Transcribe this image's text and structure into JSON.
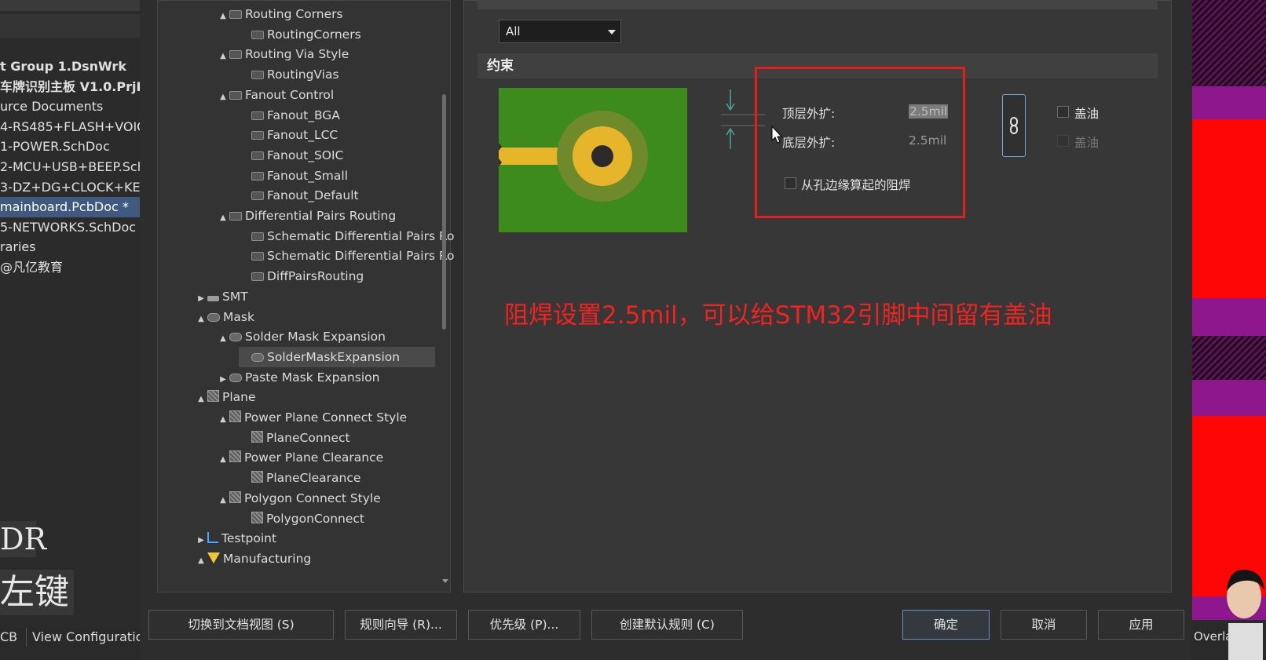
{
  "project_panel": {
    "items": [
      {
        "label": "t Group 1.DsnWrk",
        "bold": true,
        "selected": false
      },
      {
        "label": "车牌识别主板 V1.0.PrjP",
        "bold": true,
        "selected": false
      },
      {
        "label": "urce Documents",
        "bold": false,
        "selected": false
      },
      {
        "label": "4-RS485+FLASH+VOICI",
        "bold": false,
        "selected": false
      },
      {
        "label": "1-POWER.SchDoc",
        "bold": false,
        "selected": false
      },
      {
        "label": "2-MCU+USB+BEEP.SchI",
        "bold": false,
        "selected": false
      },
      {
        "label": "3-DZ+DG+CLOCK+KEY",
        "bold": false,
        "selected": false
      },
      {
        "label": "mainboard.PcbDoc *",
        "bold": false,
        "selected": true
      },
      {
        "label": "5-NETWORKS.SchDoc",
        "bold": false,
        "selected": false
      },
      {
        "label": "raries",
        "bold": false,
        "selected": false
      },
      {
        "label": "@凡亿教育",
        "bold": false,
        "selected": false
      }
    ],
    "overlay_text_1": "DR",
    "overlay_text_2": "左键",
    "bottom_tab_1": "CB",
    "bottom_tab_2": "View Configuration"
  },
  "rule_tree": {
    "nodes": [
      {
        "label": "Routing Corners",
        "level": 2,
        "arrow": "▲",
        "icon": "route"
      },
      {
        "label": "RoutingCorners",
        "level": 3,
        "arrow": "",
        "icon": "route"
      },
      {
        "label": "Routing Via Style",
        "level": 2,
        "arrow": "▲",
        "icon": "route"
      },
      {
        "label": "RoutingVias",
        "level": 3,
        "arrow": "",
        "icon": "route"
      },
      {
        "label": "Fanout Control",
        "level": 2,
        "arrow": "▲",
        "icon": "route"
      },
      {
        "label": "Fanout_BGA",
        "level": 3,
        "arrow": "",
        "icon": "route"
      },
      {
        "label": "Fanout_LCC",
        "level": 3,
        "arrow": "",
        "icon": "route"
      },
      {
        "label": "Fanout_SOIC",
        "level": 3,
        "arrow": "",
        "icon": "route"
      },
      {
        "label": "Fanout_Small",
        "level": 3,
        "arrow": "",
        "icon": "route"
      },
      {
        "label": "Fanout_Default",
        "level": 3,
        "arrow": "",
        "icon": "route"
      },
      {
        "label": "Differential Pairs Routing",
        "level": 2,
        "arrow": "▲",
        "icon": "route"
      },
      {
        "label": "Schematic Differential Pairs Ro",
        "level": 3,
        "arrow": "",
        "icon": "route"
      },
      {
        "label": "Schematic Differential Pairs Ro",
        "level": 3,
        "arrow": "",
        "icon": "route"
      },
      {
        "label": "DiffPairsRouting",
        "level": 3,
        "arrow": "",
        "icon": "route"
      },
      {
        "label": "SMT",
        "level": 1,
        "arrow": "▶",
        "icon": "smt"
      },
      {
        "label": "Mask",
        "level": 1,
        "arrow": "▲",
        "icon": "mask"
      },
      {
        "label": "Solder Mask Expansion",
        "level": 2,
        "arrow": "▲",
        "icon": "mask"
      },
      {
        "label": "SolderMaskExpansion",
        "level": 3,
        "arrow": "",
        "icon": "mask",
        "selected": true
      },
      {
        "label": "Paste Mask Expansion",
        "level": 2,
        "arrow": "▶",
        "icon": "mask"
      },
      {
        "label": "Plane",
        "level": 1,
        "arrow": "▲",
        "icon": "plane"
      },
      {
        "label": "Power Plane Connect Style",
        "level": 2,
        "arrow": "▲",
        "icon": "plane"
      },
      {
        "label": "PlaneConnect",
        "level": 3,
        "arrow": "",
        "icon": "plane"
      },
      {
        "label": "Power Plane Clearance",
        "level": 2,
        "arrow": "▲",
        "icon": "plane"
      },
      {
        "label": "PlaneClearance",
        "level": 3,
        "arrow": "",
        "icon": "plane"
      },
      {
        "label": "Polygon Connect Style",
        "level": 2,
        "arrow": "▲",
        "icon": "plane"
      },
      {
        "label": "PolygonConnect",
        "level": 3,
        "arrow": "",
        "icon": "plane"
      },
      {
        "label": "Testpoint",
        "level": 1,
        "arrow": "▶",
        "icon": "test"
      },
      {
        "label": "Manufacturing",
        "level": 1,
        "arrow": "▲",
        "icon": "manu"
      }
    ]
  },
  "scope": {
    "selected": "All"
  },
  "constraints": {
    "header": "约束",
    "top_expansion_label": "顶层外扩:",
    "top_expansion_value": "2.5mil",
    "bottom_expansion_label": "底层外扩:",
    "bottom_expansion_value": "2.5mil",
    "from_hole_edge_label": "从孔边缘算起的阻焊",
    "tent_top_label": "盖油",
    "tent_bottom_label": "盖油"
  },
  "annotation": "阻焊设置2.5mil，可以给STM32引脚中间留有盖油",
  "buttons": {
    "switch_doc_view": "切换到文档视图 (S)",
    "rule_wizard": "规则向导 (R)...",
    "priorities": "优先级 (P)...",
    "create_default": "创建默认规则 (C)",
    "ok": "确定",
    "cancel": "取消",
    "apply": "应用"
  },
  "pcb_side": {
    "overlay_tab": "Overlay"
  },
  "colors": {
    "pcb_green": "#3d8b1d",
    "pad_gold": "#e6b52a",
    "annotation_red": "#f2231f",
    "selection_blue": "#3f5a7e"
  }
}
